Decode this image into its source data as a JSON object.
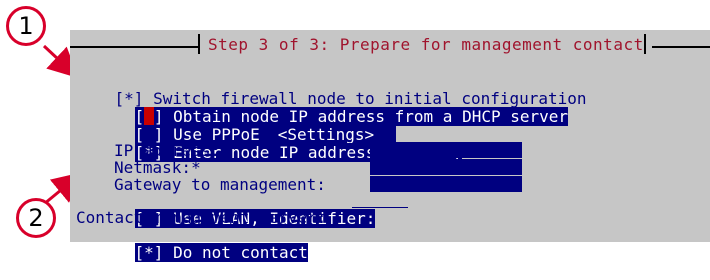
{
  "dialog": {
    "title": "Step 3 of 3: Prepare for management contact"
  },
  "options": {
    "switch_firewall": "[*] Switch firewall node to initial configuration",
    "dhcp_prefix": "[",
    "dhcp_mark": " ",
    "dhcp_suffix": "] Obtain node IP address from a DHCP server",
    "pppoe_label": "[ ] Use PPPoE",
    "pppoe_settings": "<Settings>",
    "enter_manually": "[*] Enter node IP address manually",
    "ip_address_label": "IP address:*",
    "netmask_label": "Netmask:*",
    "gateway_label": "Gateway to management:",
    "vlan_label": "[ ] Use VLAN, Identifier:",
    "contact_heading": "Contact management server:",
    "do_not_contact": "[*] Do not contact"
  },
  "callouts": {
    "one": "1",
    "two": "2"
  },
  "colors": {
    "dialog_bg": "#c6c6c6",
    "title": "#a0142d",
    "highlight": "#000080",
    "callout": "#d8002a"
  }
}
